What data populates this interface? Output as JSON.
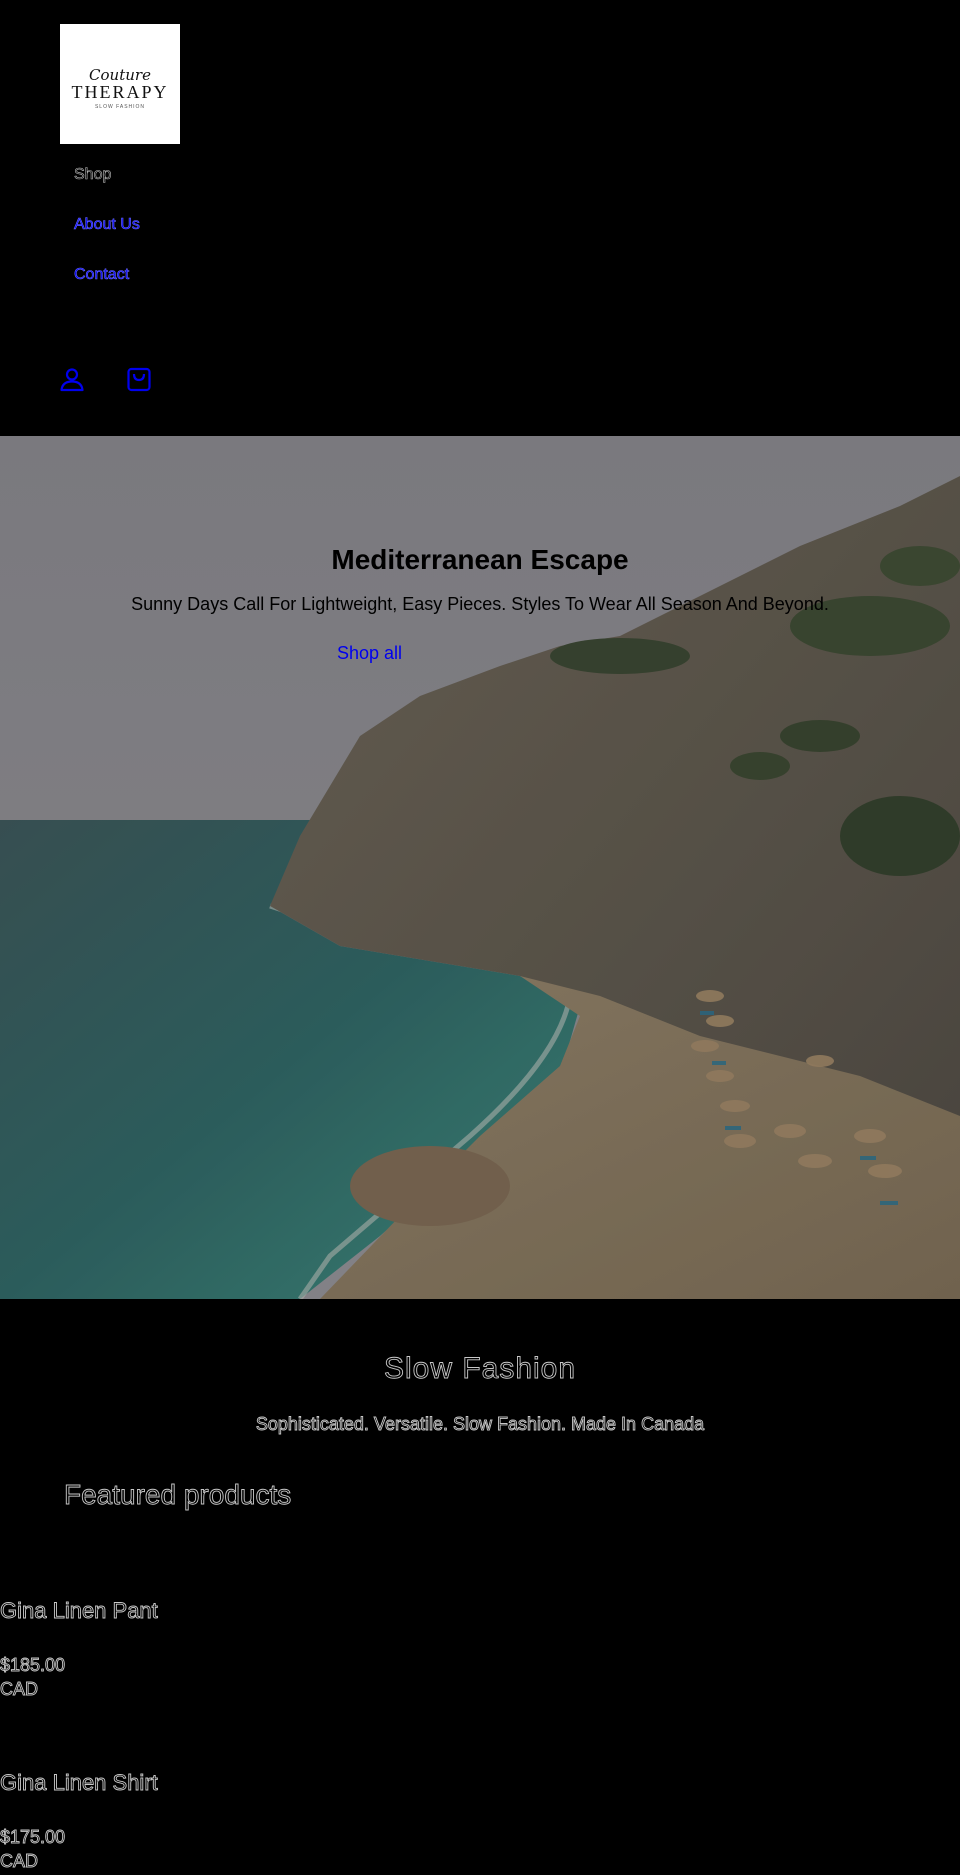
{
  "header": {
    "logo": {
      "script": "Couture",
      "word": "THERAPY",
      "tagline": "SLOW FASHION"
    },
    "nav": [
      {
        "label": "Shop"
      },
      {
        "label": "About Us"
      },
      {
        "label": "Contact"
      }
    ],
    "icons": {
      "account": "account-icon",
      "cart": "cart-icon"
    }
  },
  "hero": {
    "title": "Mediterranean Escape",
    "subtitle": "Sunny Days Call For Lightweight, Easy Pieces. Styles To Wear All Season And Beyond.",
    "link": "Shop all"
  },
  "intro": {
    "title": "Slow Fashion",
    "subtitle": "Sophisticated. Versatile. Slow Fashion. Made In Canada"
  },
  "featured": {
    "title": "Featured products",
    "products": [
      {
        "name": "Gina Linen Pant",
        "price": "$185.00",
        "currency": "CAD"
      },
      {
        "name": "Gina Linen Shirt",
        "price": "$175.00",
        "currency": "CAD"
      }
    ]
  },
  "colors": {
    "background": "#000000",
    "link": "#0000ee"
  }
}
